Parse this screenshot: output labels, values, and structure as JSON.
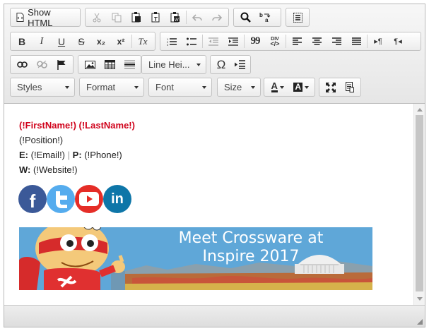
{
  "toolbar": {
    "show_html_label": "Show HTML",
    "line_height_label": "Line Hei...",
    "styles_label": "Styles",
    "format_label": "Format",
    "font_label": "Font",
    "size_label": "Size",
    "omega_glyph": "Ω",
    "bold_glyph": "B",
    "italic_glyph": "I",
    "underline_glyph": "U",
    "strike_glyph": "S",
    "subscript_glyph": "x₂",
    "superscript_glyph": "x²",
    "remove_format_glyph": "Tx",
    "blockquote_glyph": "99",
    "div_glyph": "DIV",
    "ltr_glyph": "▸¶",
    "rtl_glyph": "¶◂",
    "text_color_glyph": "A",
    "bg_color_glyph": "A"
  },
  "colors": {
    "accent_red": "#d0021b",
    "facebook": "#3b5998",
    "twitter": "#55acee",
    "youtube": "#e52d27",
    "linkedin": "#0e76a8"
  },
  "content": {
    "name_line": "(!FirstName!) (!LastName!)",
    "position": "(!Position!)",
    "email_label": "E:",
    "email_value": "(!Email!)",
    "separator": "|",
    "phone_label": "P:",
    "phone_value": "(!Phone!)",
    "website_label": "W:",
    "website_value": "(!Website!)",
    "social_icons": [
      "facebook-icon",
      "twitter-icon",
      "youtube-icon",
      "linkedin-icon"
    ],
    "social_letters": {
      "facebook": "f",
      "linkedin": "in"
    },
    "banner_line1": "Meet Crossware at",
    "banner_line2": "Inspire 2017"
  }
}
